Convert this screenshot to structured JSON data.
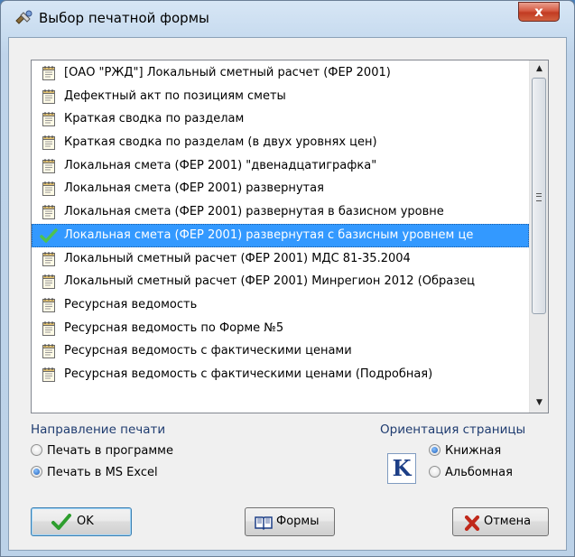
{
  "window": {
    "title": "Выбор печатной формы",
    "close_label": "x"
  },
  "list": {
    "items": [
      {
        "label": "[ОАО \"РЖД\"] Локальный сметный расчет (ФЕР 2001)",
        "icon": "document-icon"
      },
      {
        "label": "Дефектный акт по позициям сметы",
        "icon": "document-icon"
      },
      {
        "label": "Краткая сводка по разделам",
        "icon": "document-icon"
      },
      {
        "label": "Краткая сводка по разделам (в двух уровнях цен)",
        "icon": "document-icon"
      },
      {
        "label": "Локальная смета (ФЕР 2001) \"двенадцатиграфка\"",
        "icon": "document-icon"
      },
      {
        "label": "Локальная смета (ФЕР 2001) развернутая",
        "icon": "document-icon"
      },
      {
        "label": "Локальная смета (ФЕР 2001) развернутая в базисном уровне",
        "icon": "document-icon"
      },
      {
        "label": "Локальная смета (ФЕР 2001) развернутая с базисным уровнем це",
        "icon": "checkmark-icon",
        "selected": true
      },
      {
        "label": "Локальный сметный расчет (ФЕР 2001) МДС 81-35.2004",
        "icon": "document-icon"
      },
      {
        "label": "Локальный сметный расчет (ФЕР 2001) Минрегион 2012 (Образец",
        "icon": "document-icon"
      },
      {
        "label": "Ресурсная ведомость",
        "icon": "document-icon"
      },
      {
        "label": "Ресурсная ведомость по Форме №5",
        "icon": "document-icon"
      },
      {
        "label": "Ресурсная ведомость с фактическими ценами",
        "icon": "document-icon"
      },
      {
        "label": "Ресурсная ведомость с фактическими ценами (Подробная)",
        "icon": "document-icon"
      }
    ]
  },
  "print_direction": {
    "title": "Направление печати",
    "options": [
      {
        "label": "Печать в программе",
        "checked": false
      },
      {
        "label": "Печать в MS Excel",
        "checked": true
      }
    ]
  },
  "orientation": {
    "title": "Ориентация страницы",
    "icon_letter": "K",
    "options": [
      {
        "label": "Книжная",
        "checked": true
      },
      {
        "label": "Альбомная",
        "checked": false
      }
    ]
  },
  "buttons": {
    "ok": "OK",
    "forms": "Формы",
    "cancel": "Отмена"
  },
  "colors": {
    "selection": "#3399ff",
    "group_title": "#1f3c70",
    "ok_check": "#2e9e2e",
    "cancel_x": "#c0281a"
  }
}
